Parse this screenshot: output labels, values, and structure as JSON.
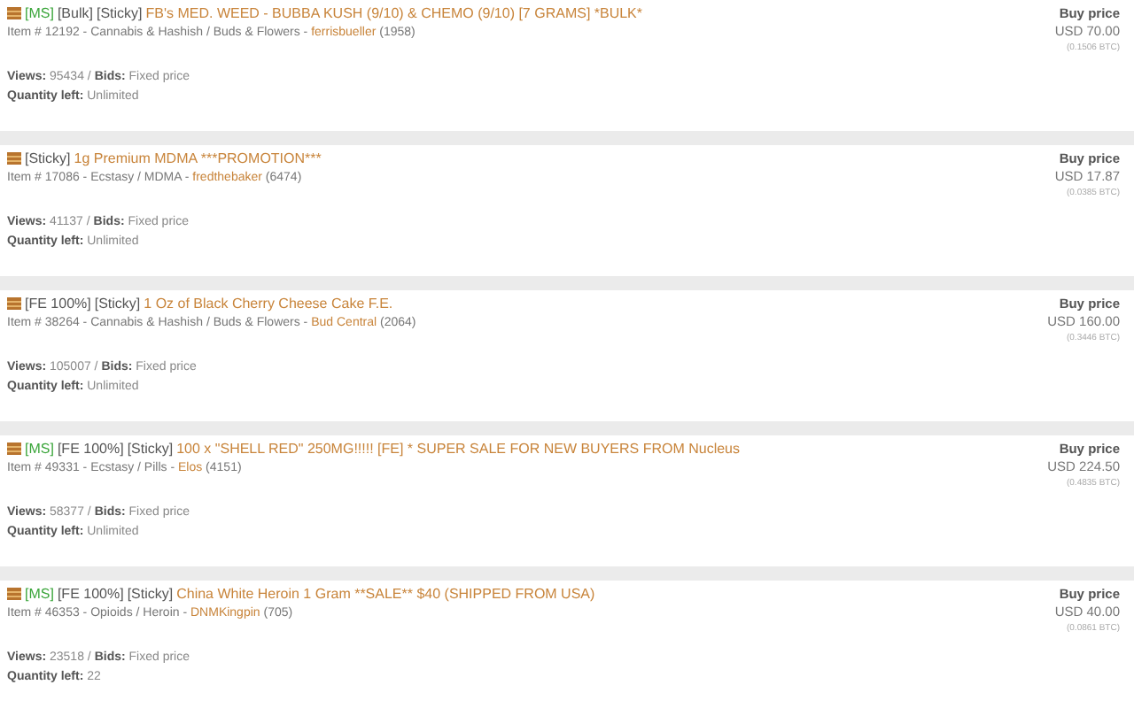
{
  "listings": [
    {
      "tags": [
        {
          "kind": "ms",
          "text": "[MS]"
        },
        {
          "kind": "plain",
          "text": "[Bulk]"
        },
        {
          "kind": "plain",
          "text": "[Sticky]"
        }
      ],
      "title": "FB's MED. WEED - BUBBA KUSH (9/10) & CHEMO (9/10) [7 GRAMS] *BULK*",
      "item": "Item # 12192 - Cannabis & Hashish / Buds & Flowers - ",
      "vendor": "ferrisbueller",
      "rating": " (1958)",
      "views_label": "Views:",
      "views": " 95434 / ",
      "bids_label": "Bids:",
      "bids": " Fixed price",
      "qty_label": "Quantity left:",
      "qty": " Unlimited",
      "price_label": "Buy price",
      "price": "USD 70.00",
      "btc": "(0.1506 BTC)"
    },
    {
      "tags": [
        {
          "kind": "plain",
          "text": "[Sticky]"
        }
      ],
      "title": "1g Premium MDMA ***PROMOTION***",
      "item": "Item # 17086 - Ecstasy / MDMA - ",
      "vendor": "fredthebaker",
      "rating": " (6474)",
      "views_label": "Views:",
      "views": " 41137 / ",
      "bids_label": "Bids:",
      "bids": " Fixed price",
      "qty_label": "Quantity left:",
      "qty": " Unlimited",
      "price_label": "Buy price",
      "price": "USD 17.87",
      "btc": "(0.0385 BTC)"
    },
    {
      "tags": [
        {
          "kind": "plain",
          "text": "[FE 100%]"
        },
        {
          "kind": "plain",
          "text": "[Sticky]"
        }
      ],
      "title": "1 Oz of Black Cherry Cheese Cake F.E.",
      "item": "Item # 38264 - Cannabis & Hashish / Buds & Flowers - ",
      "vendor": "Bud Central",
      "rating": " (2064)",
      "views_label": "Views:",
      "views": " 105007 / ",
      "bids_label": "Bids:",
      "bids": " Fixed price",
      "qty_label": "Quantity left:",
      "qty": " Unlimited",
      "price_label": "Buy price",
      "price": "USD 160.00",
      "btc": "(0.3446 BTC)"
    },
    {
      "tags": [
        {
          "kind": "ms",
          "text": "[MS]"
        },
        {
          "kind": "plain",
          "text": "[FE 100%]"
        },
        {
          "kind": "plain",
          "text": "[Sticky]"
        }
      ],
      "title": "100 x \"SHELL RED\" 250MG!!!!! [FE] * SUPER SALE FOR NEW BUYERS FROM Nucleus",
      "item": "Item # 49331 - Ecstasy / Pills - ",
      "vendor": "Elos",
      "rating": " (4151)",
      "views_label": "Views:",
      "views": " 58377 / ",
      "bids_label": "Bids:",
      "bids": " Fixed price",
      "qty_label": "Quantity left:",
      "qty": " Unlimited",
      "price_label": "Buy price",
      "price": "USD 224.50",
      "btc": "(0.4835 BTC)"
    },
    {
      "tags": [
        {
          "kind": "ms",
          "text": "[MS]"
        },
        {
          "kind": "plain",
          "text": "[FE 100%]"
        },
        {
          "kind": "plain",
          "text": "[Sticky]"
        }
      ],
      "title": "China White Heroin 1 Gram **SALE** $40 (SHIPPED FROM USA)",
      "item": "Item # 46353 - Opioids / Heroin - ",
      "vendor": "DNMKingpin",
      "rating": " (705)",
      "views_label": "Views:",
      "views": " 23518 / ",
      "bids_label": "Bids:",
      "bids": " Fixed price",
      "qty_label": "Quantity left:",
      "qty": " 22",
      "price_label": "Buy price",
      "price": "USD 40.00",
      "btc": "(0.0861 BTC)"
    }
  ]
}
